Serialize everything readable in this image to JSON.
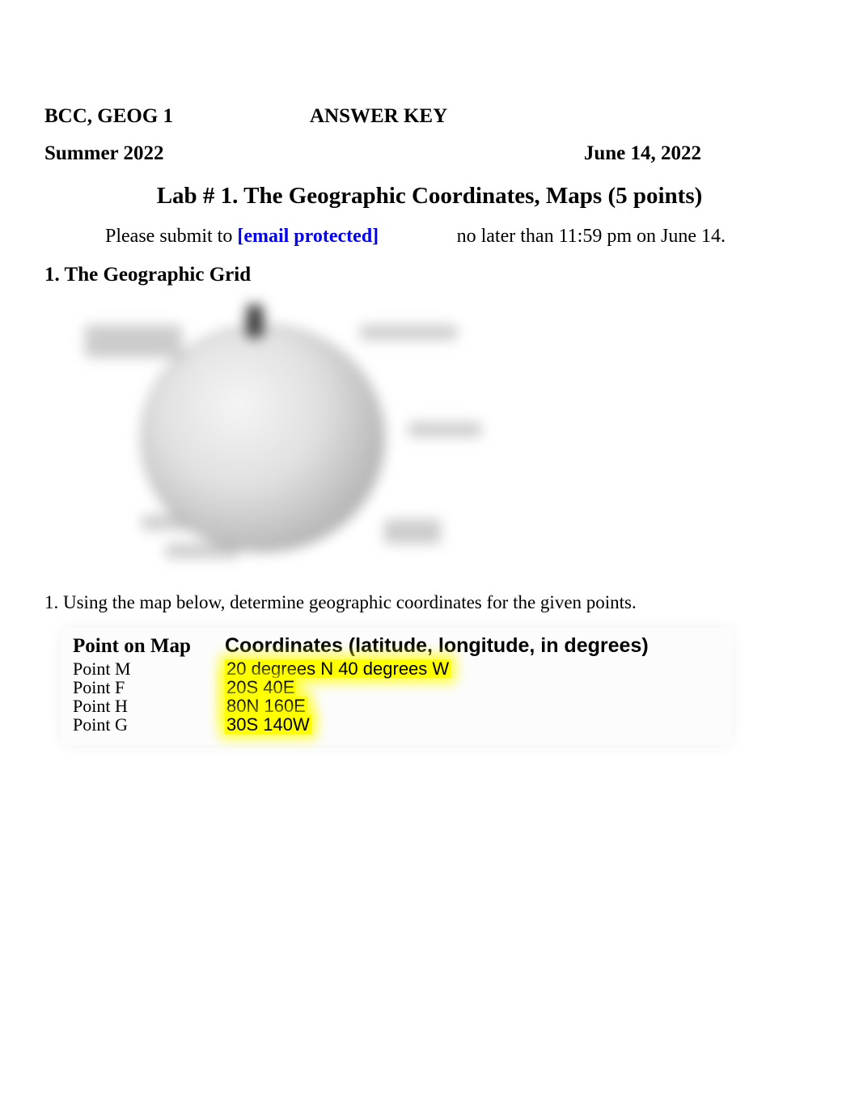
{
  "header": {
    "course": "BCC, GEOG 1",
    "answer_key": "ANSWER KEY",
    "term": "Summer 2022",
    "date": "June 14, 2022"
  },
  "lab_title": "Lab # 1. The Geographic Coordinates, Maps (5 points)",
  "submit": {
    "prefix": "Please submit to ",
    "bracket_open": "[",
    "email": "email protected",
    "bracket_close": "]",
    "deadline": "no later than 11:59 pm on June 14."
  },
  "section1_heading": "1. The Geographic Grid",
  "question1": "1. Using the map below, determine geographic coordinates for the given points.",
  "table": {
    "header_col1": "Point on Map",
    "header_col2": "Coordinates (latitude, longitude, in degrees)",
    "rows": [
      {
        "point": "Point M",
        "coords": "20 degrees N 40 degrees W"
      },
      {
        "point": "Point F",
        "coords": "20S 40E"
      },
      {
        "point": "Point H",
        "coords": "80N 160E"
      },
      {
        "point": "Point G",
        "coords": "30S 140W"
      }
    ]
  }
}
